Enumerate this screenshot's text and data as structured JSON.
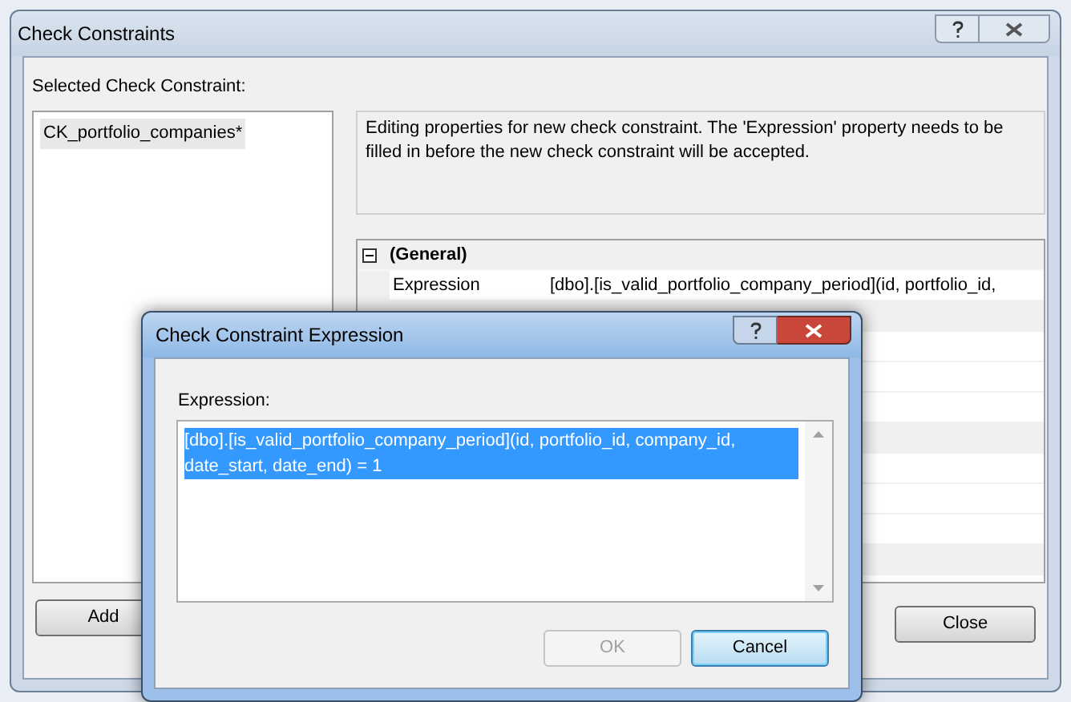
{
  "window": {
    "title": "Check Constraints",
    "active": false
  },
  "list_label": "Selected Check Constraint:",
  "constraints": [
    {
      "name": "CK_portfolio_companies*",
      "selected": true
    }
  ],
  "description": "Editing properties for new check constraint.  The 'Expression' property needs to be filled in before the new check constraint will be accepted.",
  "properties": [
    {
      "category": "(General)",
      "expanded": true,
      "rows": [
        {
          "name": "Expression",
          "value": "[dbo].[is_valid_portfolio_company_period](id, portfolio_id,"
        }
      ]
    }
  ],
  "buttons": [
    {
      "label": "Add",
      "disabled": false
    },
    {
      "label": "Close",
      "disabled": false
    }
  ],
  "expression_dialog": {
    "title": "Check Constraint Expression",
    "active": true,
    "label": "Expression:",
    "value": "[dbo].[is_valid_portfolio_company_period](id, portfolio_id, company_id, date_start, date_end) = 1",
    "text_selected": true,
    "buttons": [
      {
        "label": "OK",
        "disabled": true,
        "default": false
      },
      {
        "label": "Cancel",
        "disabled": false,
        "default": true
      }
    ]
  }
}
